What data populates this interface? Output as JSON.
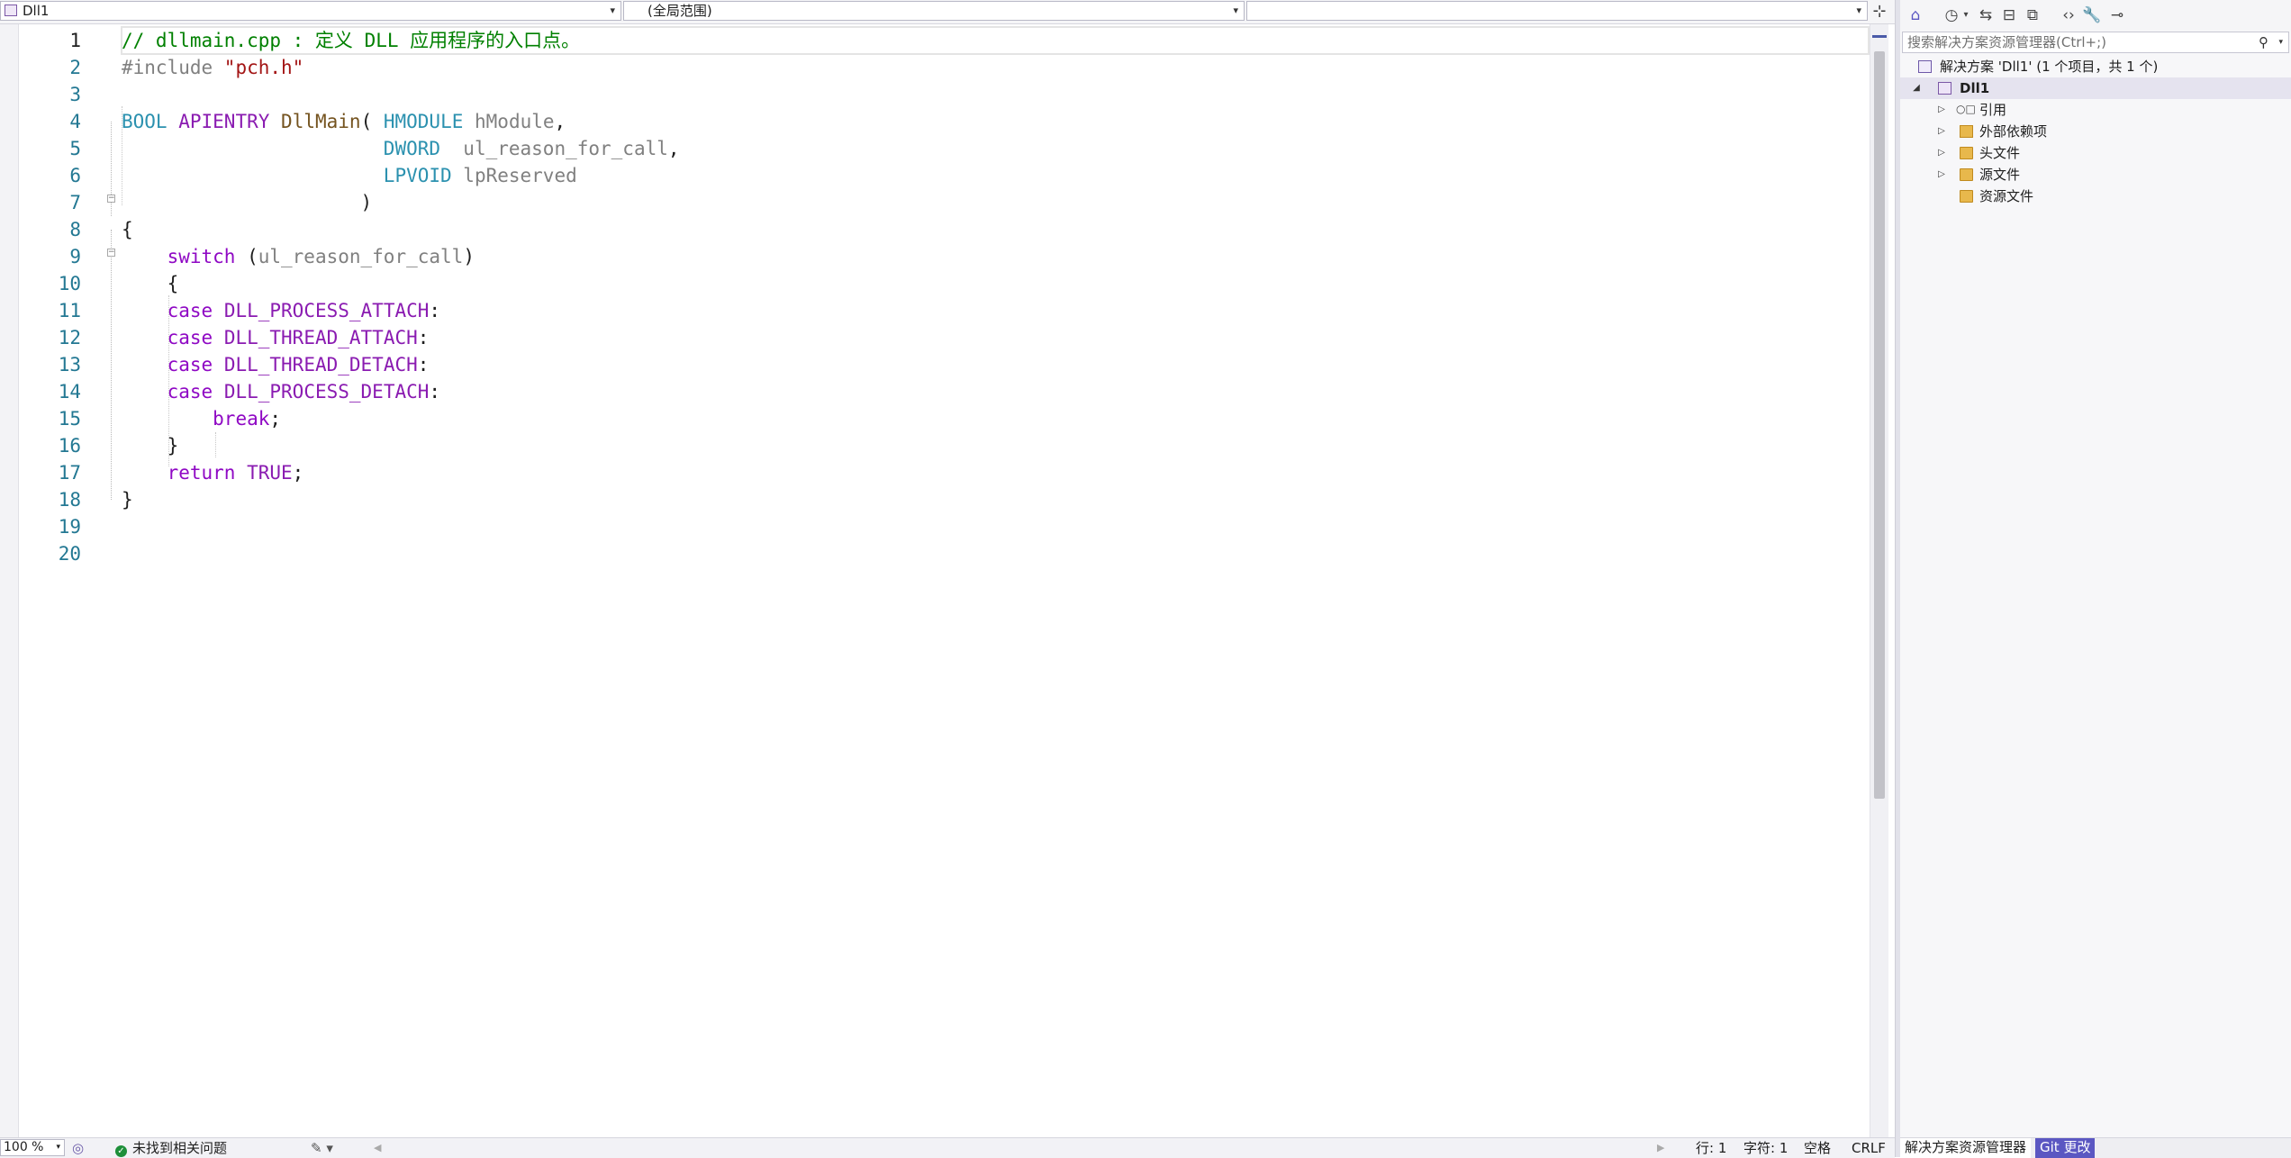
{
  "navbar": {
    "project": "Dll1",
    "scope": "(全局范围)",
    "member": ""
  },
  "editor": {
    "line_numbers": [
      "1",
      "2",
      "3",
      "4",
      "5",
      "6",
      "7",
      "8",
      "9",
      "10",
      "11",
      "12",
      "13",
      "14",
      "15",
      "16",
      "17",
      "18",
      "19",
      "20"
    ],
    "lines": {
      "l1_comment": "// dllmain.cpp : 定义 DLL 应用程序的入口点。",
      "l2_directive": "#include ",
      "l2_string": "\"pch.h\"",
      "l4_bool": "BOOL",
      "l4_apientry": "APIENTRY",
      "l4_fn": "DllMain",
      "l4_paren": "( ",
      "l4_type": "HMODULE",
      "l4_param": " hModule",
      "l4_comma": ",",
      "l5_type": "DWORD",
      "l5_param": "  ul_reason_for_call",
      "l5_comma": ",",
      "l6_type": "LPVOID",
      "l6_param": " lpReserved",
      "l7_close": ")",
      "l8_brace": "{",
      "l9_switch": "switch",
      "l9_open": " (",
      "l9_param": "ul_reason_for_call",
      "l9_close": ")",
      "l10_brace": "{",
      "l11_case": "case",
      "l11_macro": "DLL_PROCESS_ATTACH",
      "l12_case": "case",
      "l12_macro": "DLL_THREAD_ATTACH",
      "l13_case": "case",
      "l13_macro": "DLL_THREAD_DETACH",
      "l14_case": "case",
      "l14_macro": "DLL_PROCESS_DETACH",
      "colon": ":",
      "l15_break": "break",
      "semicolon": ";",
      "l16_brace": "}",
      "l17_return": "return",
      "l17_true": "TRUE",
      "l18_brace": "}"
    }
  },
  "statusbar": {
    "zoom": "100 %",
    "issues": "未找到相关问题",
    "line": "行: 1",
    "char": "字符: 1",
    "spaces": "空格",
    "eol": "CRLF"
  },
  "solution_explorer": {
    "search_placeholder": "搜索解决方案资源管理器(Ctrl+;)",
    "solution_label": "解决方案 'Dll1' (1 个项目，共 1 个)",
    "project": "Dll1",
    "items": [
      "引用",
      "外部依赖项",
      "头文件",
      "源文件",
      "资源文件"
    ],
    "tabs": [
      "解决方案资源管理器",
      "Git 更改"
    ]
  },
  "colors": {
    "comment": "#008000",
    "keyword": "#8f08c4",
    "type": "#2b91af",
    "string": "#a31515",
    "function": "#74531f",
    "git_tab": "#5b57c2"
  },
  "icons": [
    "project-icon",
    "split-icon",
    "solution-icon",
    "references-icon",
    "filter-folder-icon",
    "home-icon",
    "history-icon",
    "sync-icon",
    "collapse-icon",
    "view-icon",
    "code-icon",
    "wrench-icon",
    "pin-icon",
    "search-icon",
    "check-circle-icon",
    "brush-icon"
  ]
}
